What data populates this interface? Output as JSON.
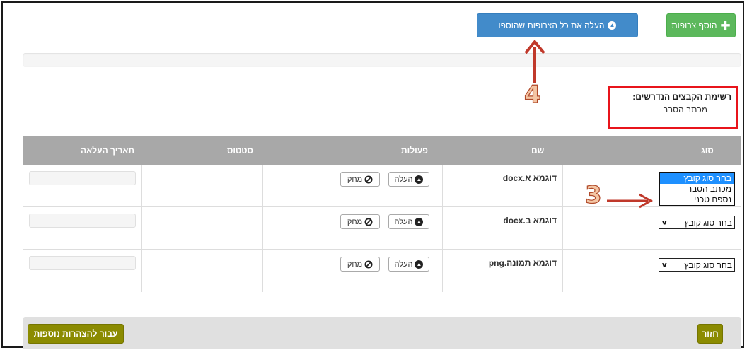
{
  "toolbar": {
    "add_label": "הוסף צרופות",
    "upload_all_label": "העלה את כל הצרופות שהוספו"
  },
  "required_files": {
    "title": "רשימת הקבצים הנדרשים:",
    "items": [
      "מכתב הסבר"
    ]
  },
  "annotations": [
    "4",
    "3"
  ],
  "table": {
    "headers": {
      "type": "סוג",
      "name": "שם",
      "actions": "פעולות",
      "status": "סטטוס",
      "upload_date": "תאריך העלאה"
    },
    "upload_label": "העלה",
    "delete_label": "מחק",
    "rows": [
      {
        "type_selected": "בחר סוג קובץ",
        "name": "דוגמא א.docx",
        "status": "",
        "upload_date": "",
        "dropdown_open": true
      },
      {
        "type_selected": "בחר סוג קובץ",
        "name": "דוגמא ב.docx",
        "status": "",
        "upload_date": ""
      },
      {
        "type_selected": "בחר סוג קובץ",
        "name": "דוגמא תמונה.png",
        "status": "",
        "upload_date": ""
      }
    ],
    "type_options": [
      "בחר סוג קובץ",
      "מכתב הסבר",
      "נספח טכני"
    ]
  },
  "footer": {
    "back_label": "חזור",
    "more_label": "עבור להצהרות נוספות"
  },
  "colors": {
    "add_button": "#5cb85c",
    "upload_all_button": "#428bca",
    "table_header": "#a8a8a8",
    "footer_button": "#8b8b00",
    "annotation_box": "#e8141b",
    "annotation_arrow": "#c0392b"
  }
}
